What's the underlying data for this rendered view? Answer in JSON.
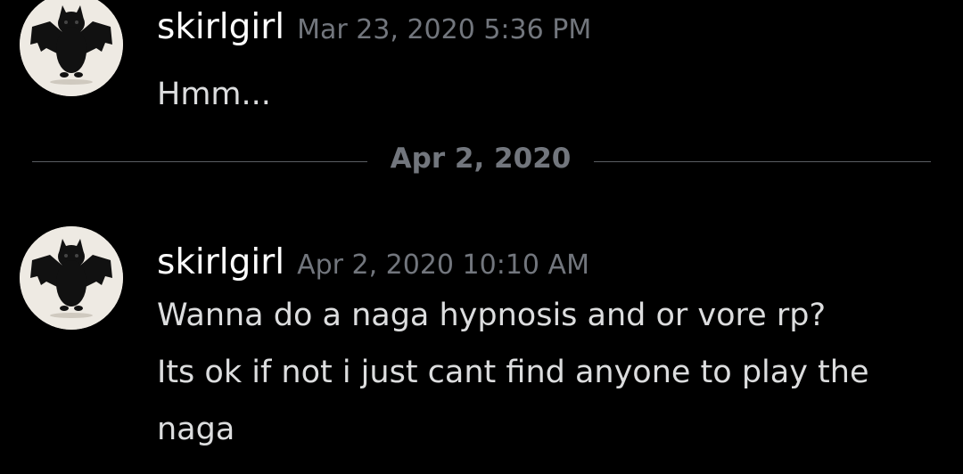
{
  "messages": [
    {
      "author": "skirlgirl",
      "timestamp": "Mar 23, 2020 5:36 PM",
      "lines": [
        "Hmm..."
      ],
      "avatar_icon": "bat-cat-avatar-icon"
    },
    {
      "author": "skirlgirl",
      "timestamp": "Apr 2, 2020 10:10 AM",
      "lines": [
        "Wanna do a naga hypnosis and or vore rp?",
        "Its ok if not i just cant find anyone to play the",
        "naga"
      ],
      "avatar_icon": "bat-cat-avatar-icon"
    }
  ],
  "date_divider": {
    "label": "Apr 2, 2020"
  },
  "colors": {
    "background": "#000000",
    "username": "#ffffff",
    "timestamp": "#72767d",
    "message_text": "#dcddde",
    "divider_line": "#5a5d63"
  }
}
